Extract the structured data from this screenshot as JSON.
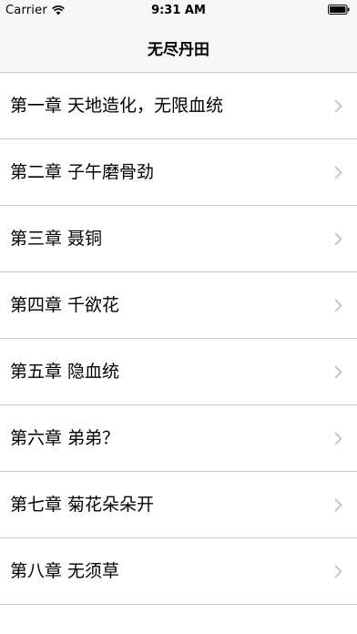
{
  "status_bar": {
    "carrier": "Carrier",
    "time": "9:31 AM",
    "icons": [
      "wifi-icon",
      "battery-icon"
    ]
  },
  "nav": {
    "title": "无尽丹田"
  },
  "chapters": [
    {
      "label": "第一章 天地造化，无限血统"
    },
    {
      "label": "第二章 子午磨骨劲"
    },
    {
      "label": "第三章 聂铜"
    },
    {
      "label": "第四章 千欲花"
    },
    {
      "label": "第五章 隐血统"
    },
    {
      "label": "第六章 弟弟？"
    },
    {
      "label": "第七章 菊花朵朵开"
    },
    {
      "label": "第八章 无须草"
    }
  ],
  "colors": {
    "bar_background": "#f7f7f8",
    "separator": "#c8c7cc",
    "chevron": "#c7c7cc"
  }
}
